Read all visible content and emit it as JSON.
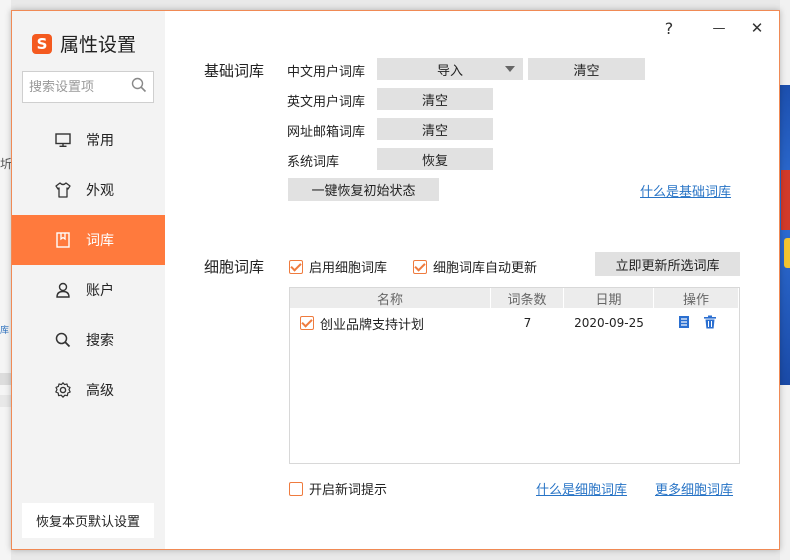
{
  "app": {
    "brand_logo": "S",
    "title": "属性设置",
    "brand_color": "#f45a1f",
    "accent_color": "#ff7a3d",
    "link_color": "#2874c6"
  },
  "window": {
    "help": "?",
    "minimize": "—",
    "close": "✕"
  },
  "sidebar": {
    "search_placeholder": "搜索设置项",
    "items": [
      {
        "label": "常用",
        "icon": "monitor-icon"
      },
      {
        "label": "外观",
        "icon": "shirt-icon"
      },
      {
        "label": "词库",
        "icon": "book-icon",
        "active": true
      },
      {
        "label": "账户",
        "icon": "user-icon"
      },
      {
        "label": "搜索",
        "icon": "search-icon"
      },
      {
        "label": "高级",
        "icon": "gear-icon"
      }
    ],
    "restore_default": "恢复本页默认设置"
  },
  "basic": {
    "section_label": "基础词库",
    "rows": [
      {
        "label": "中文用户词库",
        "import": "导入",
        "clear": "清空"
      },
      {
        "label": "英文用户词库",
        "clear": "清空"
      },
      {
        "label": "网址邮箱词库",
        "clear": "清空"
      },
      {
        "label": "系统词库",
        "restore": "恢复"
      }
    ],
    "restore_all": "一键恢复初始状态",
    "help_link": "什么是基础词库"
  },
  "cell": {
    "section_label": "细胞词库",
    "enable": {
      "label": "启用细胞词库",
      "checked": true
    },
    "auto_update": {
      "label": "细胞词库自动更新",
      "checked": true
    },
    "update_now": "立即更新所选词库",
    "table": {
      "headers": [
        "名称",
        "词条数",
        "日期",
        "操作"
      ],
      "rows": [
        {
          "checked": true,
          "name": "创业品牌支持计划",
          "count": "7",
          "date": "2020-09-25"
        }
      ]
    },
    "new_word_hint": {
      "label": "开启新词提示",
      "checked": false
    },
    "what_link": "什么是细胞词库",
    "more_link": "更多细胞词库"
  }
}
